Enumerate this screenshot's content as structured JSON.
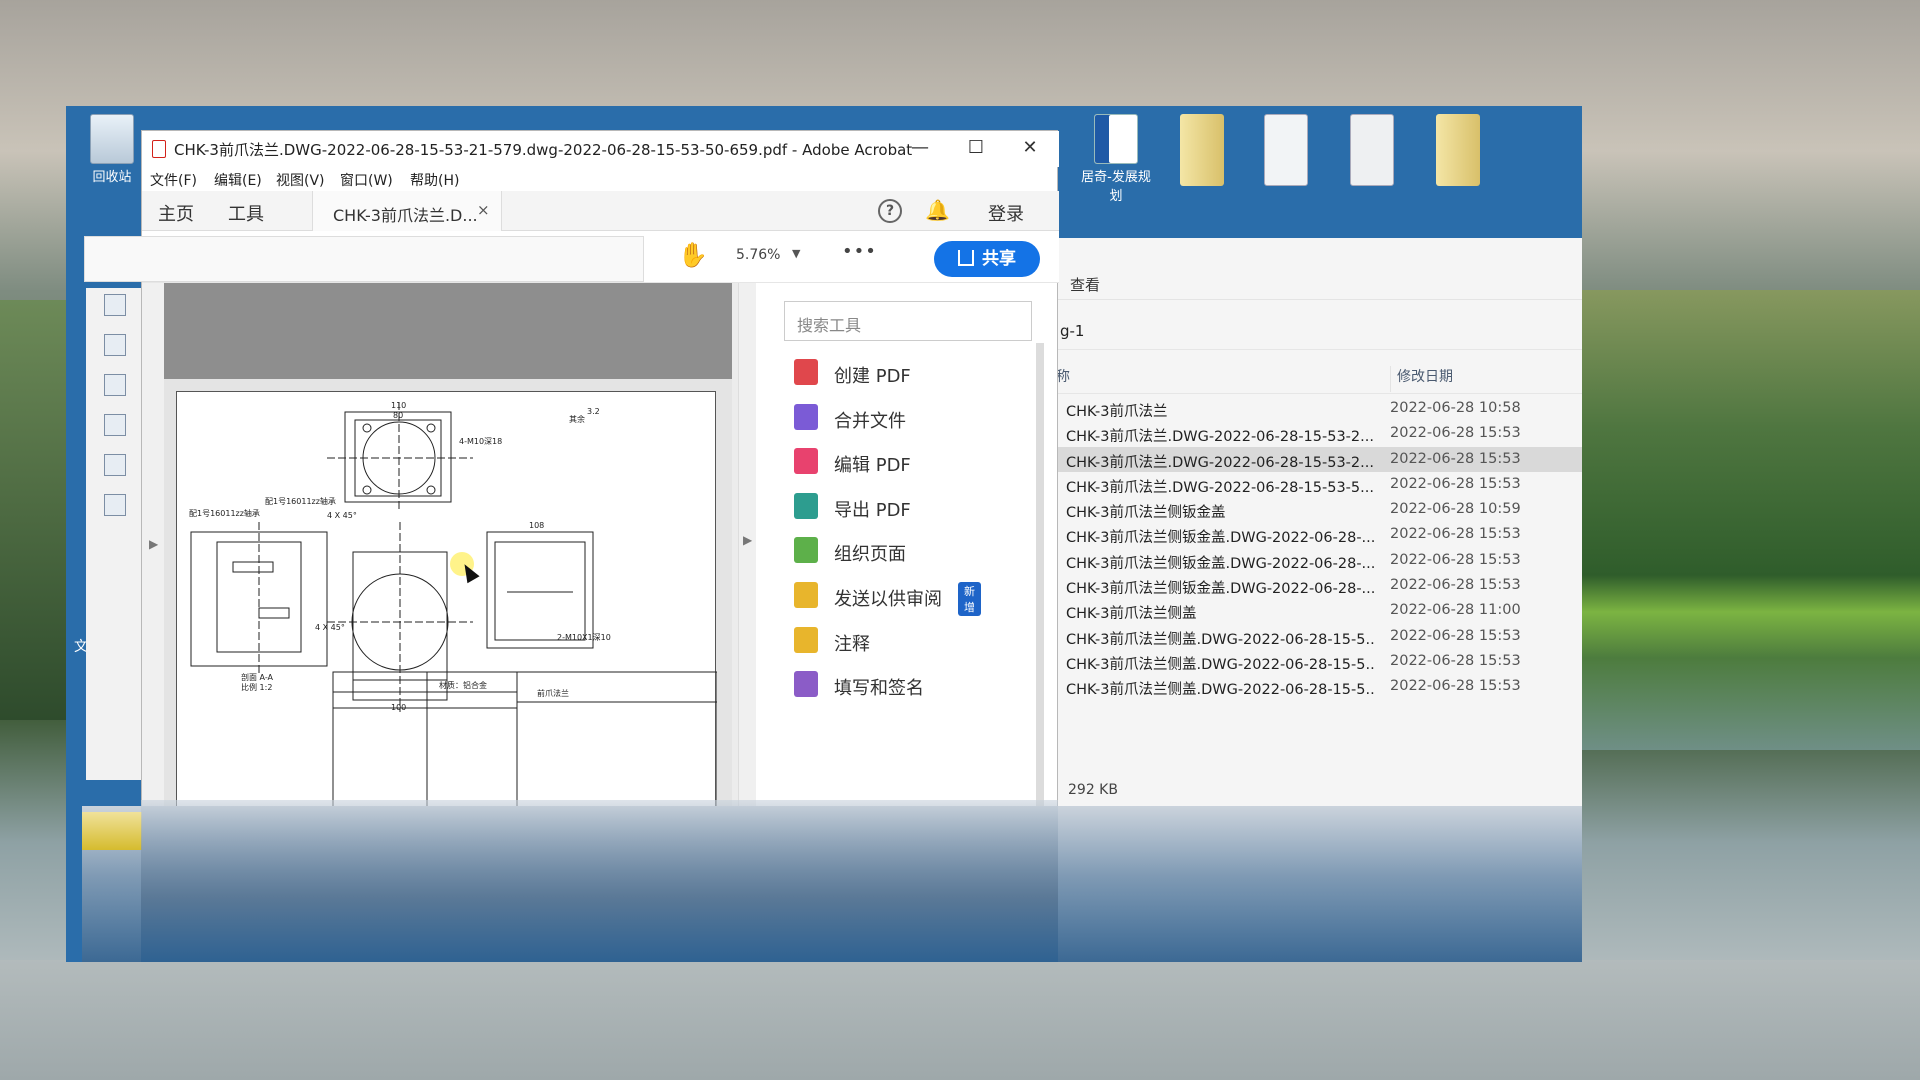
{
  "desktop": {
    "recycle_bin_label": "回收站",
    "word_doc_label": "居奇-发展规划",
    "stray_left": "文"
  },
  "explorer": {
    "ribbon_view": "查看",
    "breadcrumb_tail": "g-1",
    "col_name": "称",
    "col_date": "修改日期",
    "rows": [
      {
        "name": "CHK-3前爪法兰",
        "date": "2022-06-28 10:58"
      },
      {
        "name": "CHK-3前爪法兰.DWG-2022-06-28-15-53-2...",
        "date": "2022-06-28 15:53"
      },
      {
        "name": "CHK-3前爪法兰.DWG-2022-06-28-15-53-2...",
        "date": "2022-06-28 15:53"
      },
      {
        "name": "CHK-3前爪法兰.DWG-2022-06-28-15-53-5...",
        "date": "2022-06-28 15:53"
      },
      {
        "name": "CHK-3前爪法兰侧钣金盖",
        "date": "2022-06-28 10:59"
      },
      {
        "name": "CHK-3前爪法兰侧钣金盖.DWG-2022-06-28-...",
        "date": "2022-06-28 15:53"
      },
      {
        "name": "CHK-3前爪法兰侧钣金盖.DWG-2022-06-28-...",
        "date": "2022-06-28 15:53"
      },
      {
        "name": "CHK-3前爪法兰侧钣金盖.DWG-2022-06-28-...",
        "date": "2022-06-28 15:53"
      },
      {
        "name": "CHK-3前爪法兰侧盖",
        "date": "2022-06-28 11:00"
      },
      {
        "name": "CHK-3前爪法兰侧盖.DWG-2022-06-28-15-5...",
        "date": "2022-06-28 15:53"
      },
      {
        "name": "CHK-3前爪法兰侧盖.DWG-2022-06-28-15-5...",
        "date": "2022-06-28 15:53"
      },
      {
        "name": "CHK-3前爪法兰侧盖.DWG-2022-06-28-15-5...",
        "date": "2022-06-28 15:53"
      }
    ],
    "selected_index": 2,
    "status_size": "292 KB"
  },
  "acrobat": {
    "window_title": "CHK-3前爪法兰.DWG-2022-06-28-15-53-21-579.dwg-2022-06-28-15-53-50-659.pdf - Adobe Acrobat ...",
    "window_buttons": {
      "minimize": "—",
      "maximize": "☐",
      "close": "✕"
    },
    "menu": [
      "文件(F)",
      "编辑(E)",
      "视图(V)",
      "窗口(W)",
      "帮助(H)"
    ],
    "nav_home": "主页",
    "nav_tools": "工具",
    "doc_tab_label": "CHK-3前爪法兰.D...",
    "doc_tab_close": "×",
    "help_icon": "?",
    "login": "登录",
    "zoom": "5.76%",
    "more": "•••",
    "share": "共享",
    "tools_search_placeholder": "搜索工具",
    "tools": [
      {
        "label": "创建 PDF",
        "icon": "create-pdf-icon",
        "color": "#e0474c"
      },
      {
        "label": "合并文件",
        "icon": "combine-files-icon",
        "color": "#7b5bd6"
      },
      {
        "label": "编辑 PDF",
        "icon": "edit-pdf-icon",
        "color": "#e8426e"
      },
      {
        "label": "导出 PDF",
        "icon": "export-pdf-icon",
        "color": "#2d9d8f"
      },
      {
        "label": "组织页面",
        "icon": "organize-pages-icon",
        "color": "#5db04a"
      },
      {
        "label": "发送以供审阅",
        "icon": "send-review-icon",
        "color": "#e8b52c"
      },
      {
        "label": "注释",
        "icon": "comment-icon",
        "color": "#e8b52c"
      },
      {
        "label": "填写和签名",
        "icon": "fill-sign-icon",
        "color": "#8b5cc7"
      }
    ],
    "new_badge": "新增",
    "drawing": {
      "note_rest": "其余",
      "rough": "3.2",
      "hole_label_top": "4-M10深18",
      "hole_label_bottom": "2-M10X1深10",
      "chamfer_a": "4 X 45°",
      "chamfer_b": "4 X 45°",
      "section_label": "剖面 A-A",
      "scale_label": "比例 1:2",
      "material": "材质：铝合金",
      "part_name": "前爪法兰",
      "dim_110": "110",
      "dim_80": "80",
      "dim_108": "108",
      "dim_100": "100",
      "tol_left": "配1号16011zz轴承",
      "tol_right": "配1号16011zz轴承"
    }
  },
  "colors": {
    "accent_blue": "#1473e6",
    "desktop_blue": "#2a6daa",
    "selected_row": "#d9d9d9"
  }
}
